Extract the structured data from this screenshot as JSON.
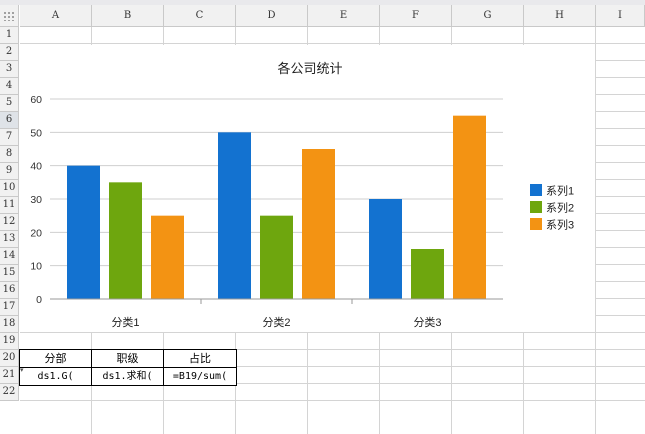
{
  "sheet": {
    "columns": [
      "A",
      "B",
      "C",
      "D",
      "E",
      "F",
      "G",
      "H",
      "I"
    ],
    "rows": [
      "1",
      "2",
      "3",
      "4",
      "5",
      "6",
      "7",
      "8",
      "9",
      "10",
      "11",
      "12",
      "13",
      "14",
      "15",
      "16",
      "17",
      "18",
      "19",
      "20",
      "21",
      "22"
    ],
    "active_row": "6"
  },
  "table": {
    "headers": [
      "分部",
      "职级",
      "占比"
    ],
    "cells": [
      "ds1.G(",
      "ds1.求和(",
      "=B19/sum("
    ],
    "anchor_mark": "▾"
  },
  "chart_data": {
    "type": "bar",
    "title": "各公司统计",
    "categories": [
      "分类1",
      "分类2",
      "分类3"
    ],
    "series": [
      {
        "name": "系列1",
        "values": [
          40,
          50,
          30
        ],
        "color": "#1372d0"
      },
      {
        "name": "系列2",
        "values": [
          35,
          25,
          15
        ],
        "color": "#6ea60e"
      },
      {
        "name": "系列3",
        "values": [
          25,
          45,
          55
        ],
        "color": "#f39313"
      }
    ],
    "ylim": [
      0,
      60
    ],
    "yticks": [
      "0",
      "10",
      "20",
      "30",
      "40",
      "50",
      "60"
    ],
    "grid": true,
    "legend": "right"
  }
}
